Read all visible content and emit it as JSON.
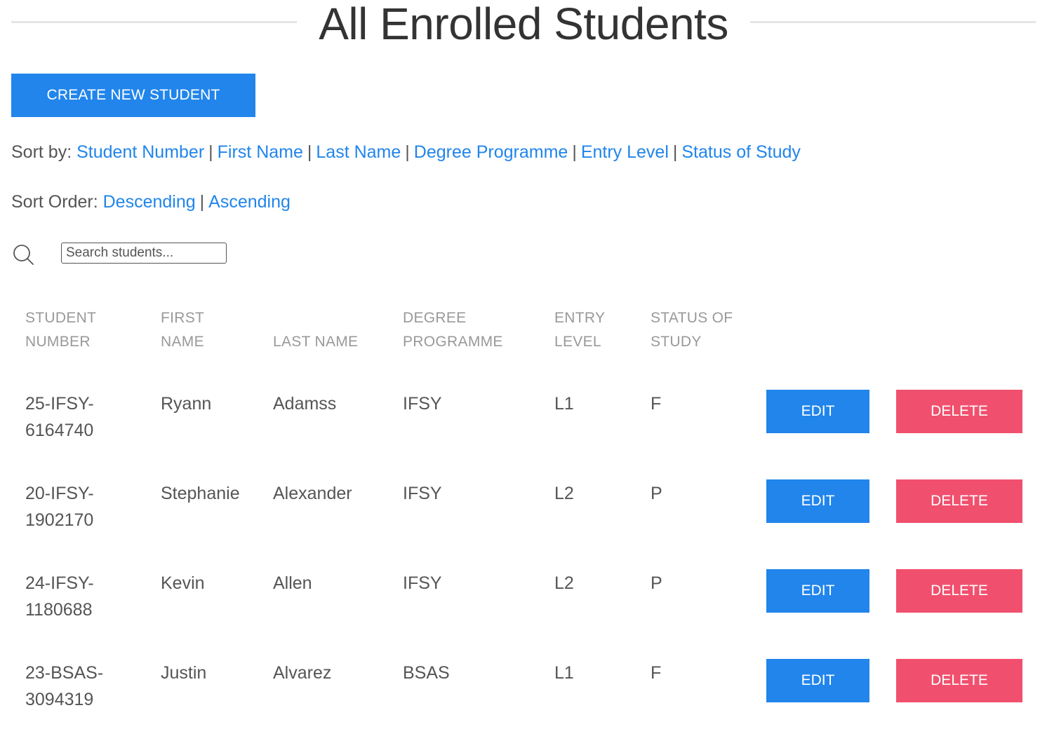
{
  "page": {
    "title": "All Enrolled Students",
    "create_button": "CREATE NEW STUDENT"
  },
  "sort_by": {
    "label": "Sort by:",
    "options": [
      "Student Number",
      "First Name",
      "Last Name",
      "Degree Programme",
      "Entry Level",
      "Status of Study"
    ],
    "separator": "|"
  },
  "sort_order": {
    "label": "Sort Order:",
    "options": [
      "Descending",
      "Ascending"
    ],
    "separator": "|"
  },
  "search": {
    "icon": "search-icon",
    "placeholder": "Search students...",
    "value": ""
  },
  "table": {
    "headers": [
      [
        "STUDENT",
        "NUMBER"
      ],
      [
        "FIRST",
        "NAME"
      ],
      [
        "",
        "LAST NAME"
      ],
      [
        "DEGREE",
        "PROGRAMME"
      ],
      [
        "ENTRY",
        "LEVEL"
      ],
      [
        "STATUS OF",
        "STUDY"
      ]
    ],
    "rows": [
      {
        "student_number": [
          "25-IFSY-",
          "6164740"
        ],
        "first_name": "Ryann",
        "last_name": "Adamss",
        "degree": "IFSY",
        "entry_level": "L1",
        "status": "F",
        "edit": "EDIT",
        "delete": "DELETE"
      },
      {
        "student_number": [
          "20-IFSY-",
          "1902170"
        ],
        "first_name": "Stephanie",
        "last_name": "Alexander",
        "degree": "IFSY",
        "entry_level": "L2",
        "status": "P",
        "edit": "EDIT",
        "delete": "DELETE"
      },
      {
        "student_number": [
          "24-IFSY-",
          "1180688"
        ],
        "first_name": "Kevin",
        "last_name": "Allen",
        "degree": "IFSY",
        "entry_level": "L2",
        "status": "P",
        "edit": "EDIT",
        "delete": "DELETE"
      },
      {
        "student_number": [
          "23-BSAS-",
          "3094319"
        ],
        "first_name": "Justin",
        "last_name": "Alvarez",
        "degree": "BSAS",
        "entry_level": "L1",
        "status": "F",
        "edit": "EDIT",
        "delete": "DELETE"
      }
    ]
  },
  "colors": {
    "primary": "#2185eb",
    "danger": "#f0506e",
    "text": "#555555",
    "heading": "#333333",
    "table_header": "#999999"
  }
}
